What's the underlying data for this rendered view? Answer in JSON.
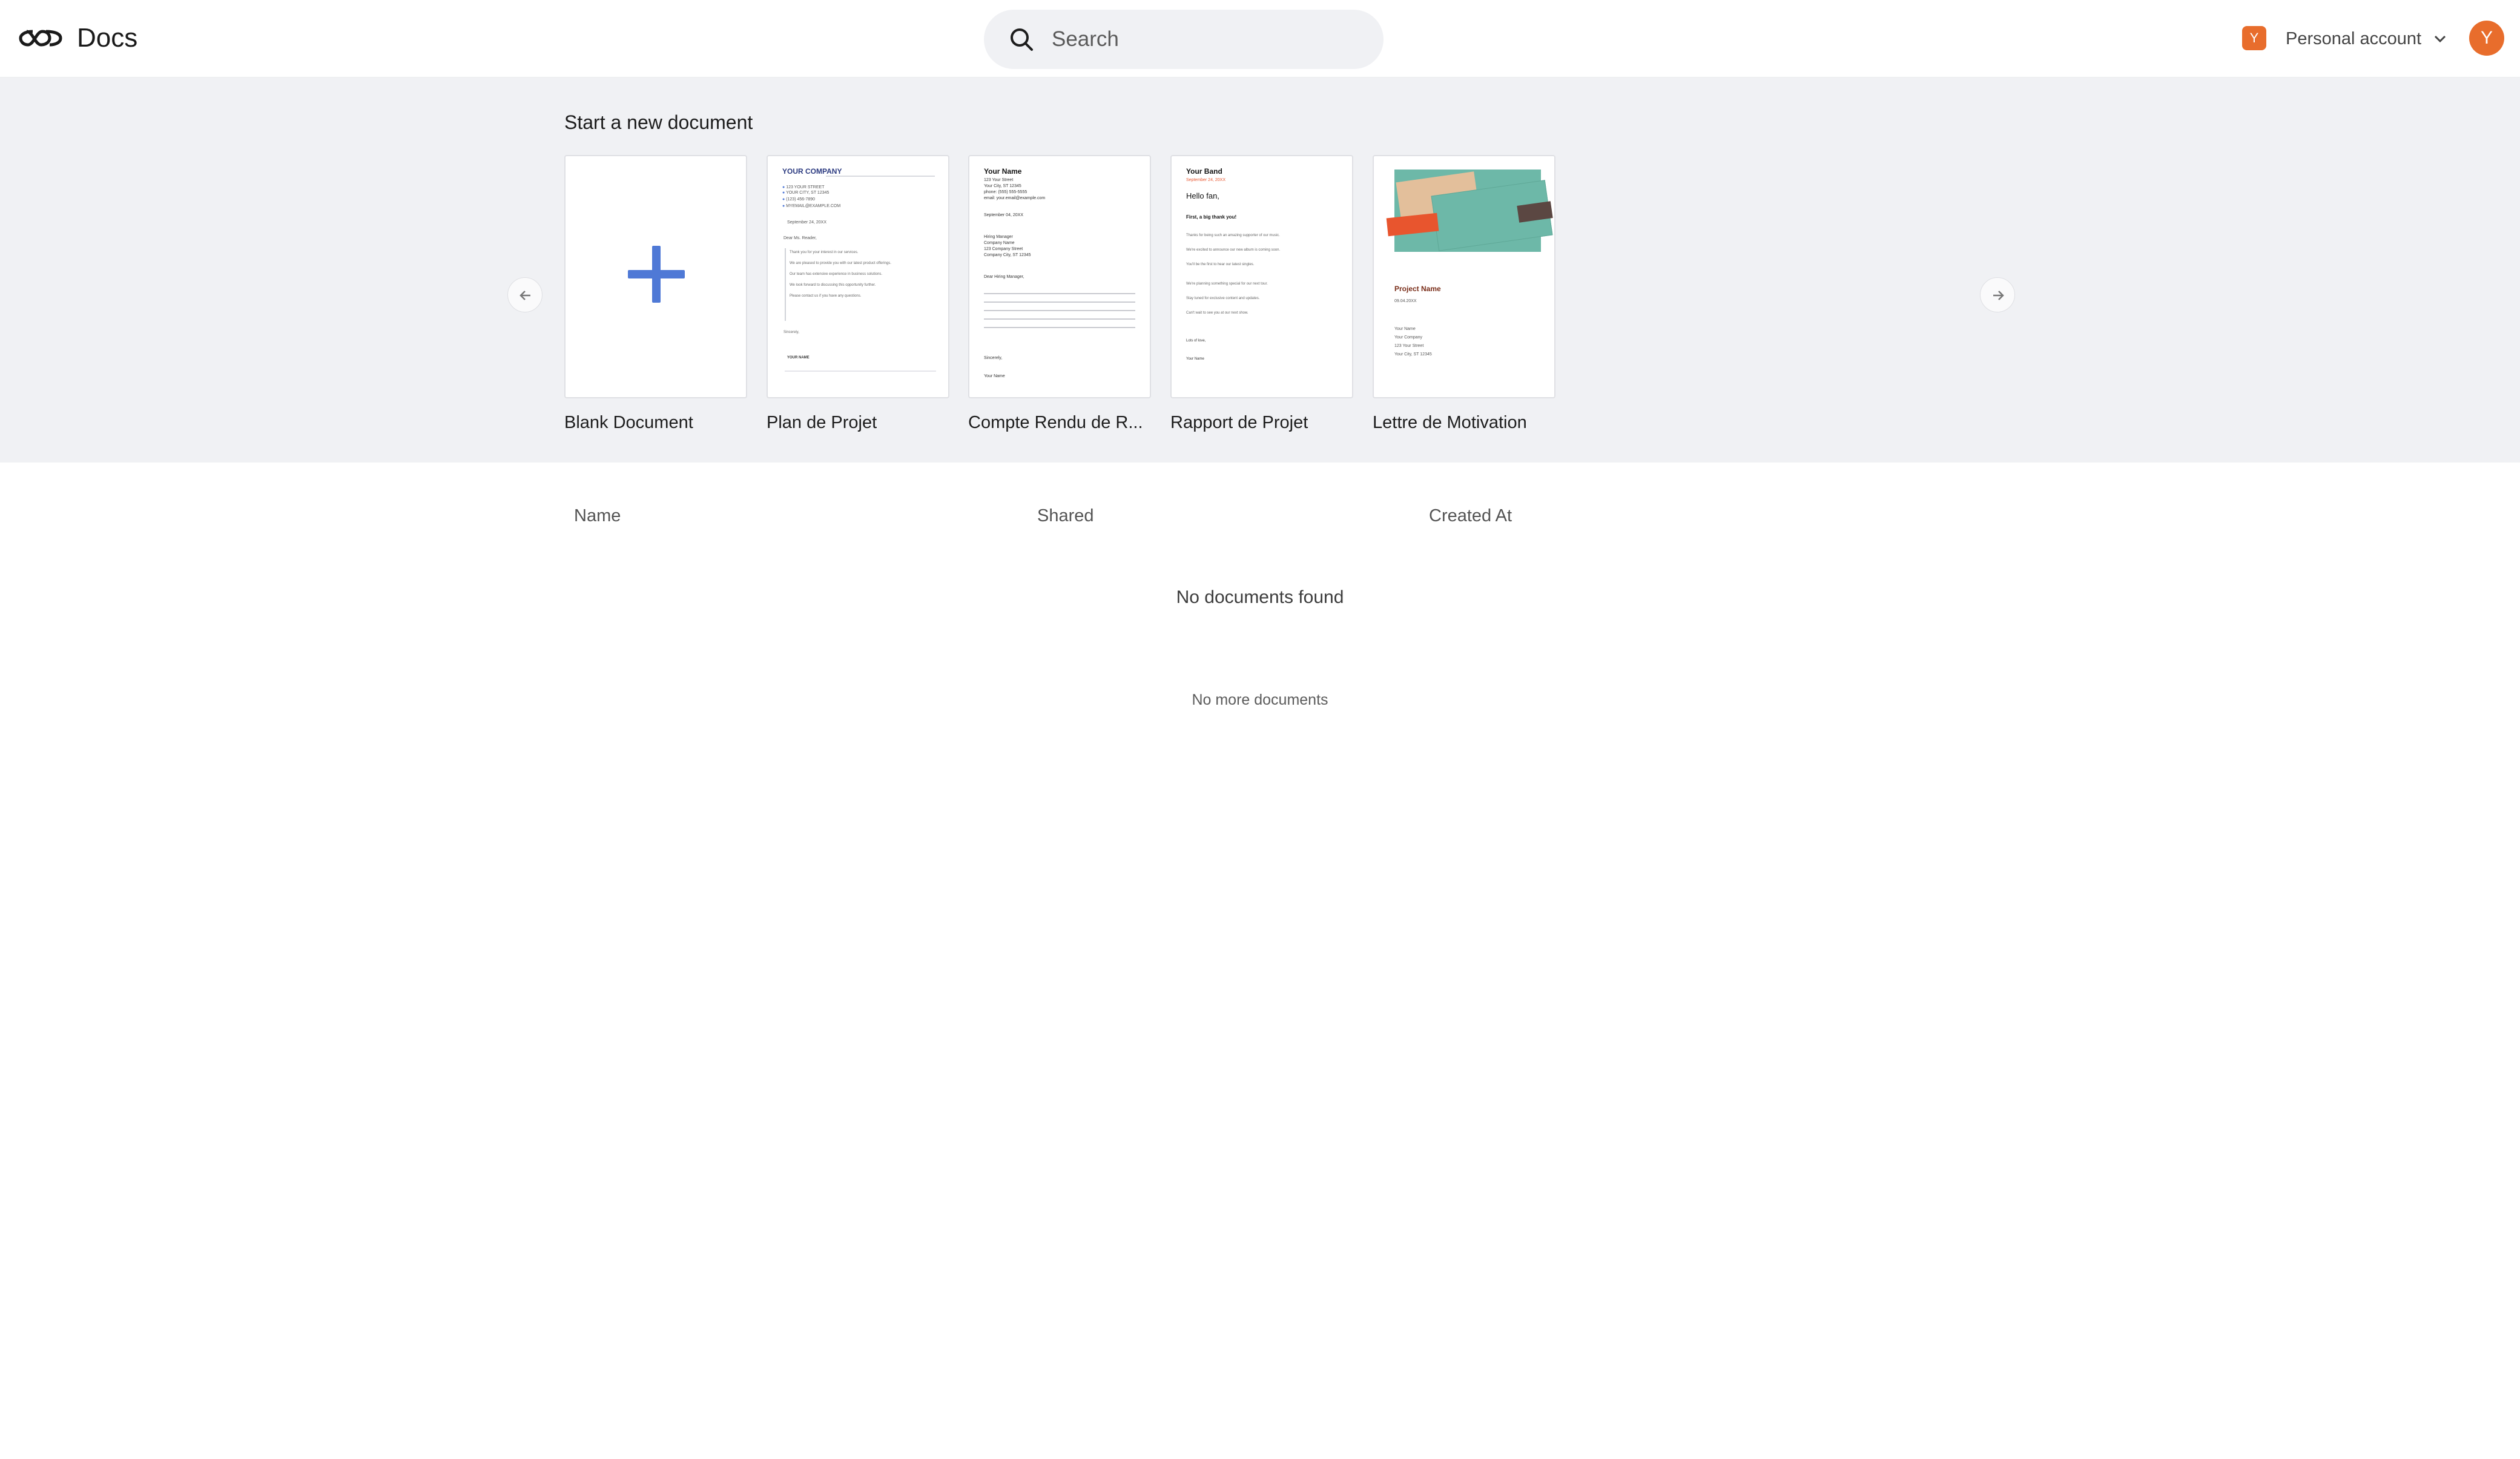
{
  "header": {
    "app_name": "Docs",
    "search_placeholder": "Search",
    "account_badge_initial": "Y",
    "account_label": "Personal account",
    "avatar_initial": "Y"
  },
  "templates": {
    "title": "Start a new document",
    "items": [
      {
        "label": "Blank Document"
      },
      {
        "label": "Plan de Projet"
      },
      {
        "label": "Compte Rendu de R..."
      },
      {
        "label": "Rapport de Projet"
      },
      {
        "label": "Lettre de Motivation"
      }
    ],
    "previews": {
      "plan": {
        "company": "YOUR COMPANY",
        "contacts": [
          "123 YOUR STREET",
          "YOUR CITY, ST 12345",
          "(123) 456-7890",
          "MYEMAIL@EXAMPLE.COM"
        ],
        "date": "September 24, 20XX",
        "greeting": "Dear Ms. Reader,",
        "body": [
          "Thank you for your interest in our services.",
          "We are pleased to provide you with our latest product offerings.",
          "Our team has extensive experience in business solutions.",
          "We look forward to discussing this opportunity further.",
          "Please contact us if you have any questions."
        ],
        "closing": "Sincerely,",
        "signature": "YOUR NAME"
      },
      "compte": {
        "name": "Your Name",
        "address": [
          "123 Your Street",
          "Your City, ST 12345",
          "phone: (555) 555-5555",
          "email: your.email@example.com"
        ],
        "date": "September 04, 20XX",
        "recipient": [
          "Hiring Manager",
          "Company Name",
          "123 Company Street",
          "Company City, ST 12345"
        ],
        "greeting": "Dear Hiring Manager,",
        "closing": "Sincerely,",
        "signature": "Your Name"
      },
      "rapport": {
        "band": "Your Band",
        "date": "September 24, 20XX",
        "hello": "Hello fan,",
        "thanks": "First, a big thank you!",
        "body": [
          "Thanks for being such an amazing supporter of our music.",
          "We're excited to announce our new album is coming soon.",
          "You'll be the first to hear our latest singles.",
          "We're planning something special for our next tour.",
          "Stay tuned for exclusive content and updates.",
          "Can't wait to see you at our next show."
        ],
        "closing": "Lots of love,",
        "signature": "Your Name"
      },
      "lettre": {
        "project": "Project Name",
        "date": "09.04.20XX",
        "details": [
          "Your Name",
          "Your Company",
          "123 Your Street",
          "Your City, ST 12345"
        ],
        "colors": {
          "teal": "#6db8a8",
          "tan": "#e3bf9b",
          "orange": "#e8552e",
          "brown": "#5b4742"
        }
      }
    }
  },
  "table": {
    "columns": [
      "Name",
      "Shared",
      "Created At"
    ],
    "empty_message": "No documents found",
    "footer_message": "No more documents"
  },
  "colors": {
    "accent": "#e86d2c",
    "plus": "#4f79d6",
    "strip_bg": "#f0f1f4"
  }
}
